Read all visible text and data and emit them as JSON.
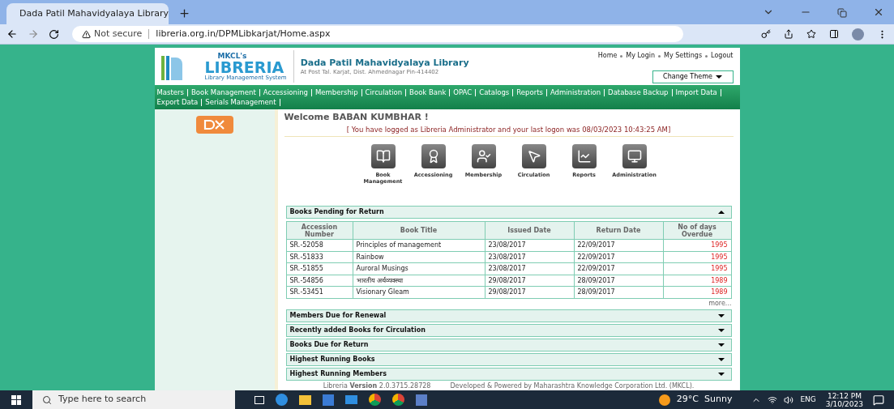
{
  "browser": {
    "tab_title": "Dada Patil Mahavidyalaya Library",
    "security": "Not secure",
    "url": "libreria.org.in/DPMLibkarjat/Home.aspx"
  },
  "header": {
    "logo_top": "MKCL's",
    "logo_main": "LIBRERIA",
    "logo_sub": "Library Management System",
    "library_name": "Dada Patil Mahavidyalaya Library",
    "library_address": "At Post Tal. Karjat, Dist. Ahmednagar Pin-414402",
    "top_links": [
      "Home",
      "My Login",
      "My Settings",
      "Logout"
    ],
    "change_theme": "Change Theme"
  },
  "nav": [
    "Masters",
    "Book Management",
    "Accessioning",
    "Membership",
    "Circulation",
    "Book Bank",
    "OPAC",
    "Catalogs",
    "Reports",
    "Administration",
    "Database Backup",
    "Import Data",
    "Export Data",
    "Serials Management"
  ],
  "welcome": {
    "title": "Welcome BABAN KUMBHAR !",
    "info": "[ You have logged as Libreria Administrator and your last logon was 08/03/2023 10:43:25 AM]"
  },
  "quick_links": [
    {
      "label": "Book Management",
      "kind": "book"
    },
    {
      "label": "Accessioning",
      "kind": "certificate"
    },
    {
      "label": "Membership",
      "kind": "member"
    },
    {
      "label": "Circulation",
      "kind": "cursor"
    },
    {
      "label": "Reports",
      "kind": "chart"
    },
    {
      "label": "Administration",
      "kind": "screens"
    }
  ],
  "panels": [
    {
      "title": "Books Pending for Return",
      "expanded": true,
      "table": {
        "columns": [
          "Accession Number",
          "Book Title",
          "Issued Date",
          "Return Date",
          "No of days Overdue"
        ],
        "rows": [
          [
            "SR.-52058",
            "Principles of management",
            "23/08/2017",
            "22/09/2017",
            "1995"
          ],
          [
            "SR.-51833",
            "Rainbow",
            "23/08/2017",
            "22/09/2017",
            "1995"
          ],
          [
            "SR.-51855",
            "Auroral Musings",
            "23/08/2017",
            "22/09/2017",
            "1995"
          ],
          [
            "SR.-54856",
            "भारतीय अर्थव्यवस्था",
            "29/08/2017",
            "28/09/2017",
            "1989"
          ],
          [
            "SR.-53451",
            "Visionary Gleam",
            "29/08/2017",
            "28/09/2017",
            "1989"
          ]
        ]
      },
      "more": "more..."
    },
    {
      "title": "Members Due for Renewal",
      "expanded": false
    },
    {
      "title": "Recently added Books for Circulation",
      "expanded": false
    },
    {
      "title": "Books Due for Return",
      "expanded": false
    },
    {
      "title": "Highest Running Books",
      "expanded": false
    },
    {
      "title": "Highest Running Members",
      "expanded": false
    }
  ],
  "footer": {
    "version": "Libreria **Version** 2.0.3715.28728",
    "credit": "Developed & Powered by Maharashtra Knowledge Corporation Ltd. (MKCL)."
  },
  "taskbar": {
    "search_placeholder": "Type here to search",
    "weather": "29°C  Sunny",
    "language": "ENG",
    "time": "12:12 PM",
    "date": "3/10/2023"
  }
}
